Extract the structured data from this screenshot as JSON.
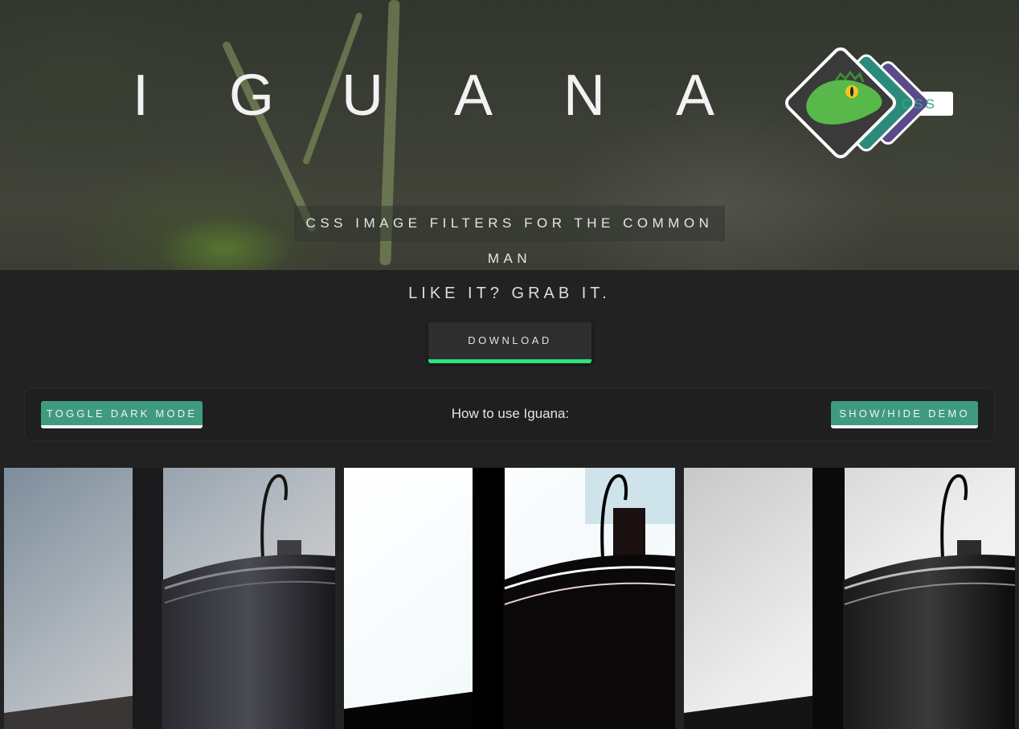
{
  "hero": {
    "title_letters": [
      "I",
      "G",
      "U",
      "A",
      "N",
      "A"
    ],
    "logo_text": "CSS",
    "subtitle": "CSS IMAGE FILTERS FOR THE COMMON MAN"
  },
  "grab": {
    "heading": "LIKE IT? GRAB IT.",
    "download_label": "DOWNLOAD"
  },
  "controls": {
    "toggle_dark_label": "TOGGLE DARK MODE",
    "how_to_label": "How to use Iguana:",
    "show_hide_label": "SHOW/HIDE DEMO"
  },
  "demo": {
    "images": [
      {
        "name": "original-photo",
        "filter": "none"
      },
      {
        "name": "high-contrast-photo",
        "filter": "high-contrast"
      },
      {
        "name": "grayscale-photo",
        "filter": "grayscale"
      }
    ]
  },
  "colors": {
    "accent_green": "#2ee082",
    "button_teal": "#3f9b80",
    "background": "#222222"
  }
}
